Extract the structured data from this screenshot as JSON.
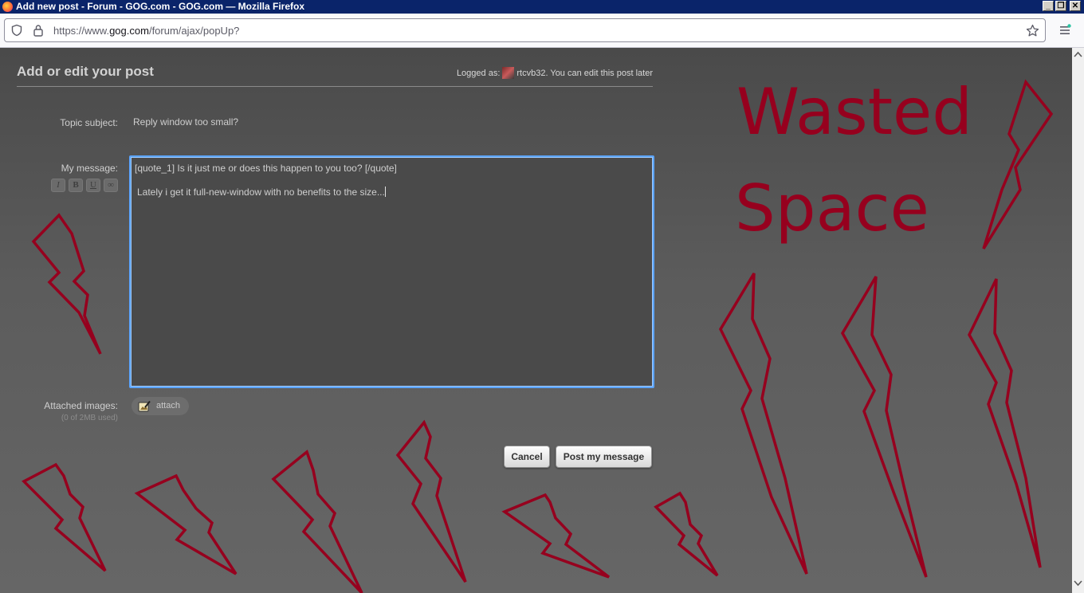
{
  "window": {
    "title": "Add new post - Forum - GOG.com - GOG.com — Mozilla Firefox",
    "controls": [
      "_",
      "❐",
      "✕"
    ]
  },
  "browser": {
    "url_prefix": "https://www.",
    "url_domain": "gog.com",
    "url_path": "/forum/ajax/popUp?"
  },
  "form": {
    "heading": "Add or edit your post",
    "logged_prefix": "Logged as:",
    "username": "rtcvb32",
    "logged_suffix": ". You can edit this post later",
    "subject_label": "Topic subject:",
    "subject_value": "Reply window too small?",
    "message_label": "My message:",
    "message_line1": "[quote_1]  Is it just me or does this happen to you too? [/quote]",
    "message_line2": "Lately i get it full-new-window with no benefits to the size...",
    "format_buttons": [
      "I",
      "B",
      "U",
      "∞"
    ],
    "attached_label": "Attached images:",
    "attached_sub": "(0 of 2MB used)",
    "attach_button": "attach",
    "cancel_button": "Cancel",
    "post_button": "Post my message"
  },
  "annotation": {
    "line1": "Wasted",
    "line2": "Space",
    "color": "#96001e"
  }
}
